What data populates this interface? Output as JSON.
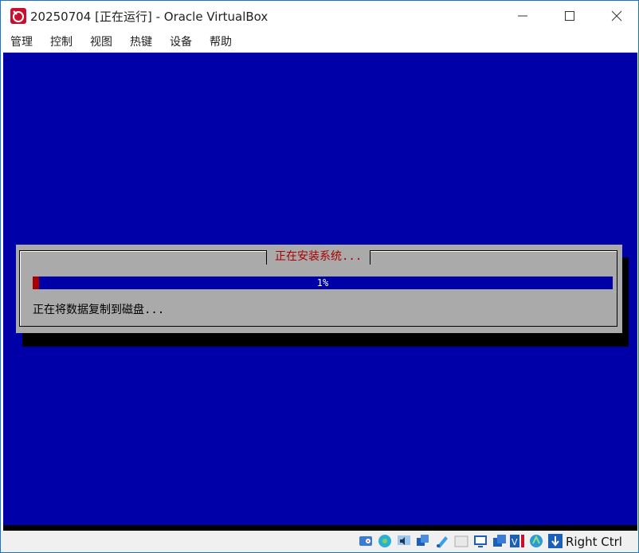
{
  "window": {
    "title": "20250704 [正在运行] - Oracle VirtualBox"
  },
  "menu": [
    "管理",
    "控制",
    "视图",
    "热键",
    "设备",
    "帮助"
  ],
  "installer": {
    "dialog_title": "正在安装系统...",
    "progress_percent": 1,
    "progress_label": "1%",
    "message": "正在将数据复制到磁盘..."
  },
  "statusbar": {
    "icons": [
      "hard-disk-icon",
      "optical-drive-icon",
      "audio-icon",
      "network-icon",
      "usb-icon",
      "shared-folders-icon",
      "display-icon",
      "video-capture-icon",
      "virtualization-icon",
      "mouse-integration-icon",
      "keyboard-icon"
    ],
    "host_key": "Right Ctrl"
  },
  "colors": {
    "vm_background": "#0000a8",
    "dialog_bg": "#aaaaaa",
    "dialog_title": "#a80000",
    "progress_fill": "#a80000"
  }
}
